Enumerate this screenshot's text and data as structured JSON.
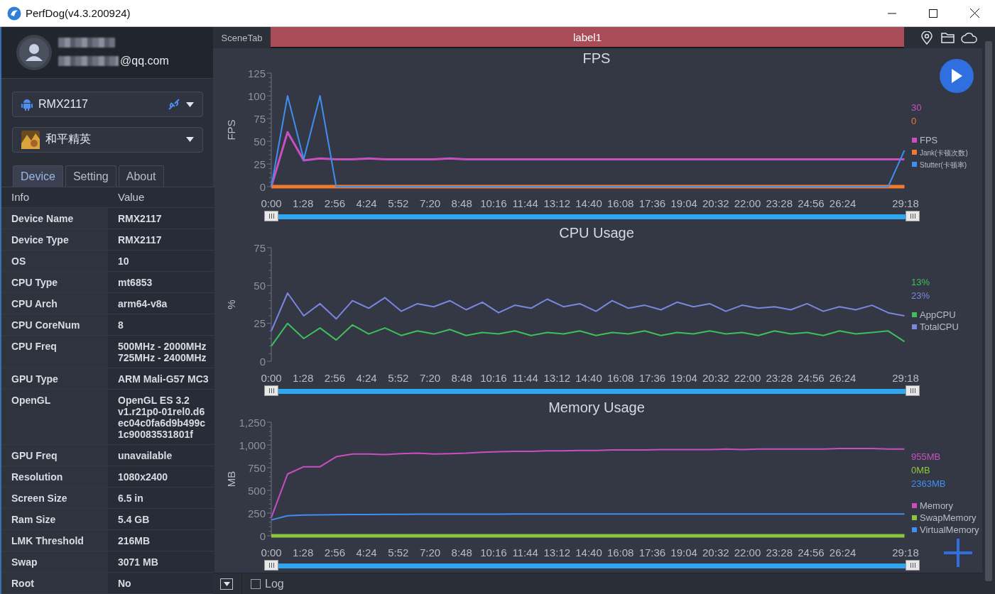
{
  "window": {
    "title": "PerfDog(v4.3.200924)"
  },
  "account": {
    "email": "@qq.com"
  },
  "device_select": {
    "value": "RMX2117"
  },
  "app_select": {
    "value": "和平精英"
  },
  "tabs": [
    {
      "label": "Device",
      "selected": true
    },
    {
      "label": "Setting",
      "selected": false
    },
    {
      "label": "About",
      "selected": false
    }
  ],
  "info_table": {
    "columns": [
      "Info",
      "Value"
    ],
    "rows": [
      {
        "info": "Device Name",
        "value": [
          "RMX2117"
        ]
      },
      {
        "info": "Device Type",
        "value": [
          "RMX2117"
        ]
      },
      {
        "info": "OS",
        "value": [
          "10"
        ]
      },
      {
        "info": "CPU Type",
        "value": [
          "mt6853"
        ]
      },
      {
        "info": "CPU Arch",
        "value": [
          "arm64-v8a"
        ]
      },
      {
        "info": "CPU CoreNum",
        "value": [
          "8"
        ]
      },
      {
        "info": "CPU Freq",
        "value": [
          "500MHz - 2000MHz",
          "725MHz - 2400MHz"
        ]
      },
      {
        "info": "GPU Type",
        "value": [
          "ARM Mali-G57 MC3"
        ]
      },
      {
        "info": "OpenGL",
        "value": [
          "OpenGL ES 3.2",
          "v1.r21p0-01rel0.d6",
          "ec04c0fa6d9b499c",
          "1c90083531801f"
        ]
      },
      {
        "info": "GPU Freq",
        "value": [
          "unavailable"
        ]
      },
      {
        "info": "Resolution",
        "value": [
          "1080x2400"
        ]
      },
      {
        "info": "Screen Size",
        "value": [
          "6.5 in"
        ]
      },
      {
        "info": "Ram Size",
        "value": [
          "5.4 GB"
        ]
      },
      {
        "info": "LMK Threshold",
        "value": [
          "216MB"
        ]
      },
      {
        "info": "Swap",
        "value": [
          "3071 MB"
        ]
      },
      {
        "info": "Root",
        "value": [
          "No"
        ]
      }
    ]
  },
  "scene": {
    "tab": "SceneTab",
    "label": "label1"
  },
  "charts": [
    {
      "readings": [
        {
          "text": "30",
          "color": "#c94fc0"
        },
        {
          "text": "0",
          "color": "#f07a30"
        }
      ],
      "slider": {
        "level": 1
      },
      "chart_data": {
        "type": "line",
        "title": "FPS",
        "ylabel": "FPS",
        "legend": "right",
        "xlim": [
          0,
          1758
        ],
        "ylim": [
          0,
          125
        ],
        "yticks": [
          0,
          25,
          50,
          75,
          100,
          125
        ],
        "x": [
          0,
          45,
          90,
          135,
          180,
          225,
          270,
          315,
          360,
          405,
          450,
          495,
          540,
          585,
          630,
          675,
          720,
          765,
          810,
          855,
          900,
          945,
          990,
          1035,
          1080,
          1125,
          1170,
          1215,
          1260,
          1305,
          1350,
          1395,
          1440,
          1485,
          1530,
          1575,
          1620,
          1665,
          1710,
          1755
        ],
        "xticks": [
          {
            "value": 0,
            "label": "0:00"
          },
          {
            "value": 88,
            "label": "1:28"
          },
          {
            "value": 176,
            "label": "2:56"
          },
          {
            "value": 264,
            "label": "4:24"
          },
          {
            "value": 352,
            "label": "5:52"
          },
          {
            "value": 440,
            "label": "7:20"
          },
          {
            "value": 528,
            "label": "8:48"
          },
          {
            "value": 616,
            "label": "10:16"
          },
          {
            "value": 704,
            "label": "11:44"
          },
          {
            "value": 792,
            "label": "13:12"
          },
          {
            "value": 880,
            "label": "14:40"
          },
          {
            "value": 968,
            "label": "16:08"
          },
          {
            "value": 1056,
            "label": "17:36"
          },
          {
            "value": 1144,
            "label": "19:04"
          },
          {
            "value": 1232,
            "label": "20:32"
          },
          {
            "value": 1320,
            "label": "22:00"
          },
          {
            "value": 1408,
            "label": "23:28"
          },
          {
            "value": 1496,
            "label": "24:56"
          },
          {
            "value": 1584,
            "label": "26:24"
          },
          {
            "value": 1758,
            "label": "29:18"
          }
        ],
        "series": [
          {
            "name": "FPS",
            "color": "#c94fc0",
            "values": [
              0,
              60,
              29,
              31,
              30,
              30,
              31,
              30,
              30,
              30,
              30,
              31,
              30,
              30,
              30,
              30,
              30,
              30,
              30,
              30,
              30,
              30,
              30,
              30,
              30,
              30,
              30,
              30,
              30,
              30,
              30,
              30,
              30,
              30,
              30,
              30,
              30,
              30,
              30,
              30
            ]
          },
          {
            "name": "Jank(卡顿次数)",
            "color": "#f07a30",
            "values": [
              0,
              0,
              0,
              0,
              0,
              0,
              0,
              0,
              0,
              0,
              0,
              0,
              0,
              0,
              0,
              0,
              0,
              0,
              0,
              0,
              0,
              0,
              0,
              0,
              0,
              0,
              0,
              0,
              0,
              0,
              0,
              0,
              0,
              0,
              0,
              0,
              0,
              0,
              0,
              0
            ]
          },
          {
            "name": "Stutter(卡顿率)",
            "color": "#3f8ff0",
            "values": [
              0,
              100,
              30,
              100,
              0,
              0,
              0,
              0,
              0,
              0,
              0,
              0,
              0,
              0,
              0,
              0,
              0,
              0,
              0,
              0,
              0,
              0,
              0,
              0,
              0,
              0,
              0,
              0,
              0,
              0,
              0,
              0,
              0,
              0,
              0,
              0,
              0,
              0,
              0,
              40
            ]
          }
        ]
      }
    },
    {
      "readings": [
        {
          "text": "13%",
          "color": "#3fbf5a"
        },
        {
          "text": "23%",
          "color": "#7b86e0"
        }
      ],
      "slider": {
        "level": 1
      },
      "chart_data": {
        "type": "line",
        "title": "CPU Usage",
        "ylabel": "%",
        "legend": "right",
        "xlim": [
          0,
          1758
        ],
        "ylim": [
          0,
          75
        ],
        "yticks": [
          0,
          25,
          50,
          75
        ],
        "x": [
          0,
          45,
          90,
          135,
          180,
          225,
          270,
          315,
          360,
          405,
          450,
          495,
          540,
          585,
          630,
          675,
          720,
          765,
          810,
          855,
          900,
          945,
          990,
          1035,
          1080,
          1125,
          1170,
          1215,
          1260,
          1305,
          1350,
          1395,
          1440,
          1485,
          1530,
          1575,
          1620,
          1665,
          1710,
          1755
        ],
        "xticks": [
          {
            "value": 0,
            "label": "0:00"
          },
          {
            "value": 88,
            "label": "1:28"
          },
          {
            "value": 176,
            "label": "2:56"
          },
          {
            "value": 264,
            "label": "4:24"
          },
          {
            "value": 352,
            "label": "5:52"
          },
          {
            "value": 440,
            "label": "7:20"
          },
          {
            "value": 528,
            "label": "8:48"
          },
          {
            "value": 616,
            "label": "10:16"
          },
          {
            "value": 704,
            "label": "11:44"
          },
          {
            "value": 792,
            "label": "13:12"
          },
          {
            "value": 880,
            "label": "14:40"
          },
          {
            "value": 968,
            "label": "16:08"
          },
          {
            "value": 1056,
            "label": "17:36"
          },
          {
            "value": 1144,
            "label": "19:04"
          },
          {
            "value": 1232,
            "label": "20:32"
          },
          {
            "value": 1320,
            "label": "22:00"
          },
          {
            "value": 1408,
            "label": "23:28"
          },
          {
            "value": 1496,
            "label": "24:56"
          },
          {
            "value": 1584,
            "label": "26:24"
          },
          {
            "value": 1758,
            "label": "29:18"
          }
        ],
        "series": [
          {
            "name": "AppCPU",
            "color": "#3fbf5a",
            "values": [
              10,
              25,
              15,
              22,
              14,
              24,
              18,
              22,
              17,
              20,
              18,
              21,
              17,
              19,
              18,
              20,
              17,
              19,
              18,
              20,
              17,
              19,
              18,
              20,
              17,
              19,
              18,
              20,
              18,
              19,
              17,
              20,
              18,
              19,
              17,
              20,
              18,
              19,
              20,
              13
            ]
          },
          {
            "name": "TotalCPU",
            "color": "#7b86e0",
            "values": [
              20,
              45,
              30,
              38,
              28,
              40,
              35,
              42,
              33,
              38,
              36,
              40,
              34,
              39,
              32,
              37,
              35,
              41,
              36,
              38,
              33,
              40,
              35,
              37,
              34,
              39,
              36,
              38,
              33,
              37,
              35,
              36,
              34,
              38,
              33,
              36,
              34,
              37,
              32,
              30
            ]
          }
        ]
      }
    },
    {
      "readings": [
        {
          "text": "955MB",
          "color": "#c94fc0"
        },
        {
          "text": "0MB",
          "color": "#8cc63f"
        },
        {
          "text": "2363MB",
          "color": "#3f8ff0"
        }
      ],
      "slider": {
        "level": 1
      },
      "chart_data": {
        "type": "line",
        "title": "Memory Usage",
        "ylabel": "MB",
        "legend": "right",
        "xlim": [
          0,
          1758
        ],
        "ylim": [
          0,
          1250
        ],
        "yticks": [
          0,
          250,
          500,
          750,
          {
            "value": 1000,
            "label": "1,000"
          },
          {
            "value": 1250,
            "label": "1,250"
          }
        ],
        "x": [
          0,
          45,
          90,
          135,
          180,
          225,
          270,
          315,
          360,
          405,
          450,
          495,
          540,
          585,
          630,
          675,
          720,
          765,
          810,
          855,
          900,
          945,
          990,
          1035,
          1080,
          1125,
          1170,
          1215,
          1260,
          1305,
          1350,
          1395,
          1440,
          1485,
          1530,
          1575,
          1620,
          1665,
          1710,
          1755
        ],
        "xticks": [
          {
            "value": 0,
            "label": "0:00"
          },
          {
            "value": 88,
            "label": "1:28"
          },
          {
            "value": 176,
            "label": "2:56"
          },
          {
            "value": 264,
            "label": "4:24"
          },
          {
            "value": 352,
            "label": "5:52"
          },
          {
            "value": 440,
            "label": "7:20"
          },
          {
            "value": 528,
            "label": "8:48"
          },
          {
            "value": 616,
            "label": "10:16"
          },
          {
            "value": 704,
            "label": "11:44"
          },
          {
            "value": 792,
            "label": "13:12"
          },
          {
            "value": 880,
            "label": "14:40"
          },
          {
            "value": 968,
            "label": "16:08"
          },
          {
            "value": 1056,
            "label": "17:36"
          },
          {
            "value": 1144,
            "label": "19:04"
          },
          {
            "value": 1232,
            "label": "20:32"
          },
          {
            "value": 1320,
            "label": "22:00"
          },
          {
            "value": 1408,
            "label": "23:28"
          },
          {
            "value": 1496,
            "label": "24:56"
          },
          {
            "value": 1584,
            "label": "26:24"
          },
          {
            "value": 1758,
            "label": "29:18"
          }
        ],
        "series": [
          {
            "name": "Memory",
            "color": "#c94fc0",
            "values": [
              200,
              680,
              760,
              760,
              870,
              900,
              900,
              895,
              905,
              910,
              900,
              905,
              910,
              920,
              925,
              930,
              930,
              935,
              935,
              940,
              940,
              945,
              945,
              945,
              950,
              950,
              950,
              950,
              955,
              950,
              955,
              955,
              955,
              955,
              955,
              960,
              960,
              960,
              955,
              955
            ]
          },
          {
            "name": "SwapMemory",
            "color": "#8cc63f",
            "values": [
              0,
              0,
              0,
              0,
              0,
              0,
              0,
              0,
              0,
              0,
              0,
              0,
              0,
              0,
              0,
              0,
              0,
              0,
              0,
              0,
              0,
              0,
              0,
              0,
              0,
              0,
              0,
              0,
              0,
              0,
              0,
              0,
              0,
              0,
              0,
              0,
              0,
              0,
              0,
              0
            ]
          },
          {
            "name": "VirtualMemory",
            "color": "#3f8ff0",
            "values": [
              175,
              220,
              228,
              230,
              232,
              235,
              235,
              236,
              237,
              238,
              238,
              238,
              239,
              239,
              239,
              240,
              240,
              240,
              240,
              240,
              240,
              240,
              240,
              240,
              240,
              240,
              240,
              240,
              240,
              240,
              240,
              240,
              240,
              240,
              240,
              240,
              240,
              240,
              240,
              240
            ]
          }
        ]
      }
    }
  ],
  "bottom_bar": {
    "log": {
      "label": "Log",
      "checked": false
    }
  }
}
